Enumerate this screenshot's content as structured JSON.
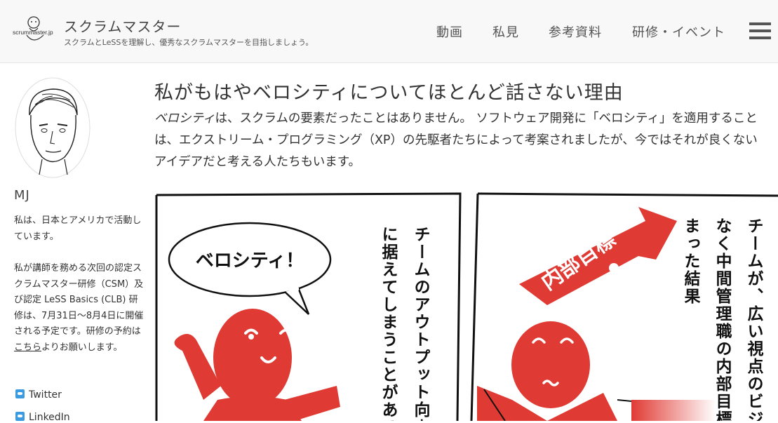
{
  "header": {
    "logo_text": "scrummaster.jp",
    "site_title": "スクラムマスター",
    "site_description": "スクラムとLeSSを理解し、優秀なスクラムマスターを目指しましょう。",
    "nav": [
      {
        "label": "動画"
      },
      {
        "label": "私見"
      },
      {
        "label": "参考資料"
      },
      {
        "label": "研修・イベント"
      }
    ]
  },
  "sidebar": {
    "author": "MJ",
    "bio_1": "私は、日本とアメリカで活動しています。",
    "bio_2a": "私が講師を務める次回の認定スクラムマスター研修（CSM）及び認定 LeSS Basics (CLB) 研修は、7月31日〜8月4日に開催される予定です。研修の予約は",
    "bio_link": "こちら",
    "bio_2b": "よりお願いします。",
    "social": [
      {
        "label": "Twitter",
        "icon": "twitter-icon"
      },
      {
        "label": "LinkedIn",
        "icon": "linkedin-icon"
      }
    ]
  },
  "post": {
    "title": "私がもはやベロシティについてほとんど話さない理由",
    "intro_emph": "ベロシティ",
    "intro_rest": "は、スクラムの要素だったことはありません。 ソフトウェア開発に「ベロシティ」を適用することは、エクストリーム・プログラミング（XP）の先駆者たちによって考案されましたが、今ではそれが良くないアイデアだと考える人たちもいます。"
  },
  "comic": {
    "speech": "ベロシティ！",
    "panel1_col1": "チームのアウトプット向上",
    "panel1_col2": "に据えてしまうことがある",
    "panel2_col1": "チームが、広い視点のビジ",
    "panel2_col2": "なく中間管理職の内部目標",
    "panel2_col3": "まった結果",
    "flag": "内部目標"
  },
  "colors": {
    "header_bg": "#f8f8f8",
    "character_red": "#e03a34",
    "twitter_blue": "#3a9be0"
  }
}
